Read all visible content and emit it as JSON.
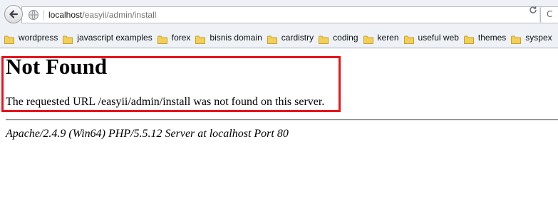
{
  "browser": {
    "url_host": "localhost",
    "url_path": "/easyii/admin/install",
    "next_box_text": "C",
    "icons": {
      "back": "back-arrow-icon",
      "site": "globe-icon",
      "reload": "reload-icon",
      "folder": "folder-icon"
    }
  },
  "bookmarks": [
    {
      "label": "wordpress"
    },
    {
      "label": "javascript examples"
    },
    {
      "label": "forex"
    },
    {
      "label": "bisnis domain"
    },
    {
      "label": "cardistry"
    },
    {
      "label": "coding"
    },
    {
      "label": "keren"
    },
    {
      "label": "useful web"
    },
    {
      "label": "themes"
    },
    {
      "label": "syspex"
    }
  ],
  "page": {
    "heading": "Not Found",
    "message": "The requested URL /easyii/admin/install was not found on this server.",
    "address": "Apache/2.4.9 (Win64) PHP/5.5.12 Server at localhost Port 80"
  },
  "colors": {
    "highlight_border": "#e8141c",
    "folder_fill": "#f2cf59",
    "chrome_bg": "#eef1f6"
  }
}
